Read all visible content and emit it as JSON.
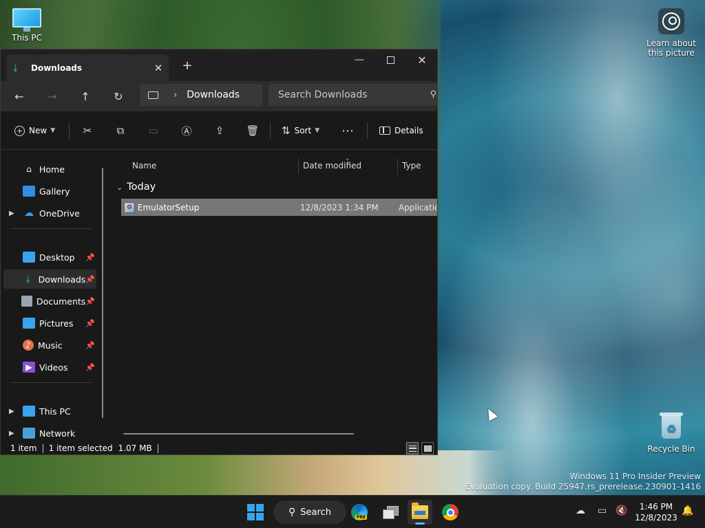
{
  "desktop": {
    "this_pc_label": "This PC",
    "learn_label": "Learn about this picture",
    "recycle_label": "Recycle Bin",
    "watermark_line1": "Windows 11 Pro Insider Preview",
    "watermark_line2": "Evaluation copy. Build 25947.rs_prerelease.230901-1416"
  },
  "window": {
    "tab_title": "Downloads",
    "address_crumb": "Downloads",
    "search_placeholder": "Search Downloads",
    "commands": {
      "new_label": "New",
      "sort_label": "Sort",
      "details_label": "Details"
    },
    "sidebar": {
      "items": [
        {
          "label": "Home"
        },
        {
          "label": "Gallery"
        },
        {
          "label": "OneDrive"
        },
        {
          "label": "Desktop"
        },
        {
          "label": "Downloads"
        },
        {
          "label": "Documents"
        },
        {
          "label": "Pictures"
        },
        {
          "label": "Music"
        },
        {
          "label": "Videos"
        },
        {
          "label": "This PC"
        },
        {
          "label": "Network"
        }
      ]
    },
    "columns": {
      "name": "Name",
      "date": "Date modified",
      "type": "Type"
    },
    "group_label": "Today",
    "files": [
      {
        "name": "EmulatorSetup",
        "date": "12/8/2023 1:34 PM",
        "type": "Application"
      }
    ],
    "status": {
      "count": "1 item",
      "selection": "1 item selected",
      "size": "1.07 MB"
    }
  },
  "taskbar": {
    "search_label": "Search",
    "time": "1:46 PM",
    "date": "12/8/2023"
  },
  "colors": {
    "accent": "#3aa3f0",
    "download_green": "#35c06e",
    "selection": "#777777"
  }
}
